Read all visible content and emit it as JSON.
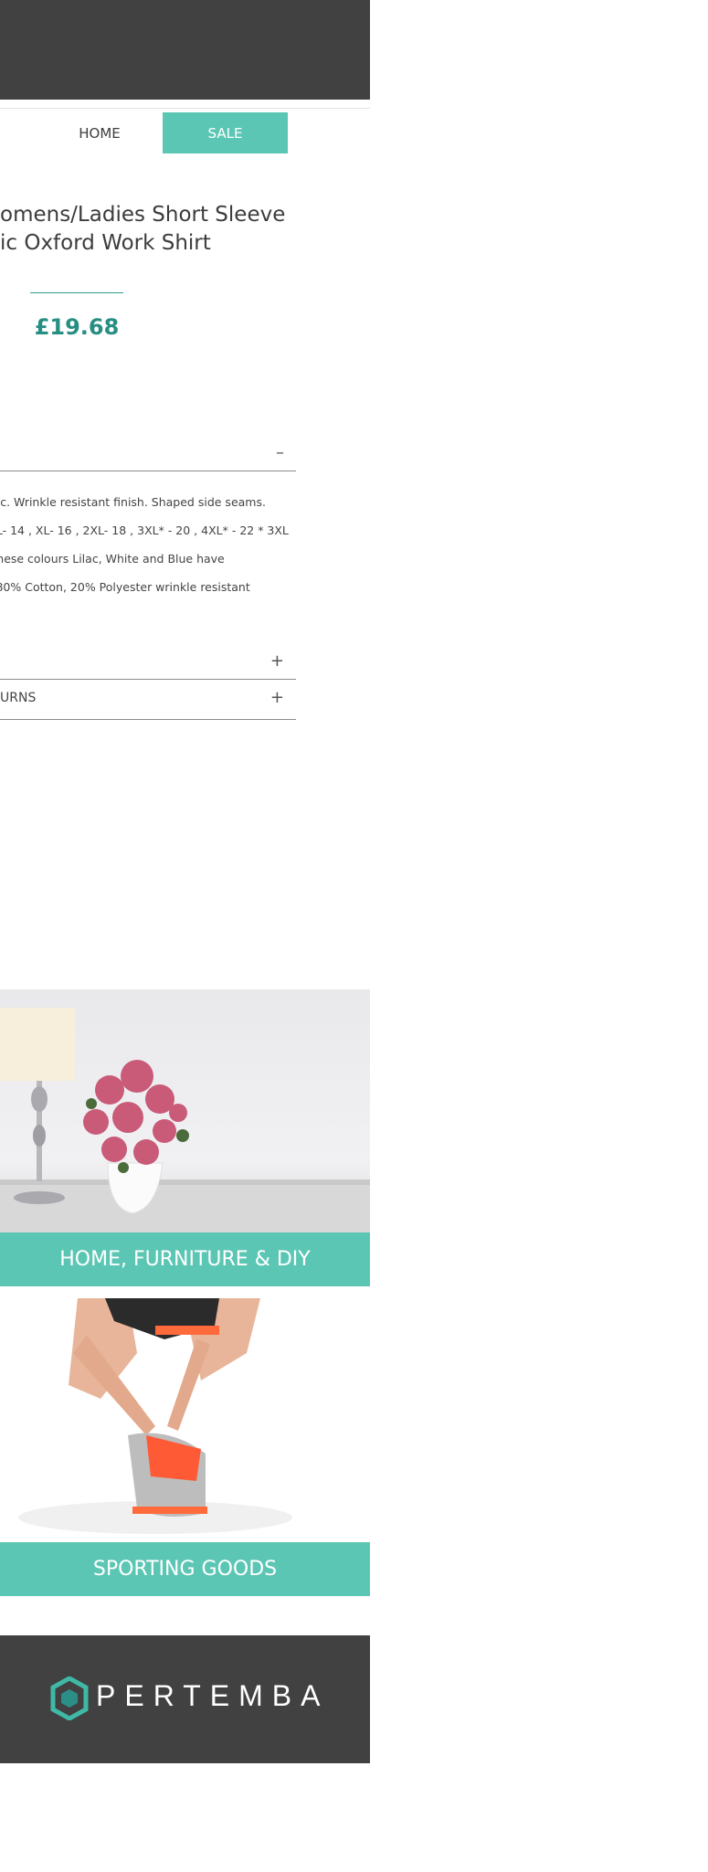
{
  "nav": {
    "home": "HOME",
    "sale": "SALE"
  },
  "product": {
    "title_line1": "omens/Ladies Short Sleeve",
    "title_line2": "ic Oxford Work Shirt",
    "price": "£19.68"
  },
  "accordion": {
    "info_toggle": "–",
    "description_lines": [
      "abric. Wrinkle resistant finish. Shaped side seams.",
      "2 , L- 14 , XL- 16 , 2XL- 18 , 3XL* - 20 , 4XL* - 22 * 3XL",
      " in these colours Lilac, White and Blue have",
      "ric 80% Cotton, 20% Polyester wrinkle resistant"
    ],
    "section2_toggle": "+",
    "returns_label": "URNS",
    "returns_toggle": "+"
  },
  "categories": [
    {
      "label": "HOME, FURNITURE & DIY"
    },
    {
      "label": "SPORTING GOODS"
    }
  ],
  "footer": {
    "logo_text": "PERTEMBA"
  },
  "colors": {
    "teal": "#5cc6b4",
    "dark_teal": "#278e83",
    "header_gray": "#414141"
  }
}
